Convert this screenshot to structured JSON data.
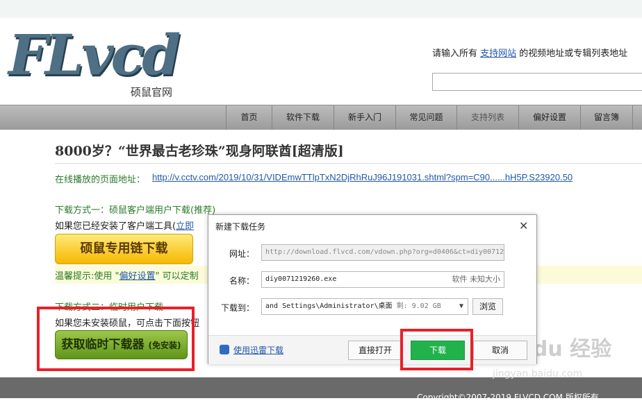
{
  "logo": {
    "text": "FLvcd",
    "subtitle": "硕鼠官网"
  },
  "header": {
    "hint_prefix": "请输入所有 ",
    "hint_link": "支持网站",
    "hint_suffix": " 的视频地址或专辑列表地址"
  },
  "nav": [
    "首页",
    "软件下载",
    "新手入门",
    "常见问题",
    "支持列表",
    "偏好设置",
    "留言簿"
  ],
  "page": {
    "title": "8000岁？“世界最古老珍珠”现身阿联酋[超清版]",
    "play_label": "在线播放的页面地址：",
    "play_url": "http://v.cctv.com/2019/10/31/VIDEmwTTlpTxN2DjRhRuJ96J191031.shtml?spm=C90......hH5P.S23920.50",
    "method1": "下载方式一：硕鼠客户端用户下载(推荐)",
    "installed_prefix": "如果您已经安装了客户端工具(",
    "installed_link": "立即",
    "client_button": "硕鼠专用链下载",
    "tip_prefix": "温馨提示:使用 \"",
    "tip_link": "偏好设置",
    "tip_suffix": "\" 可以定制",
    "method2": "下载方式二：临时用户下载",
    "not_installed": "如果您未安装硕鼠，可点击下面按钮",
    "temp_button": "获取临时下载器",
    "temp_button_small": "(免安装)"
  },
  "dialog": {
    "title": "新建下载任务",
    "close_glyph": "✕",
    "url_label": "网址：",
    "url_value": "http://download.flvcd.com/vdown.php?org=d0406&ct=diy00712",
    "name_label": "名称：",
    "name_value": "diy0071219260.exe",
    "name_meta": "软件 未知大小",
    "path_label": "下载到：",
    "path_value": "and Settings\\Administrator\\桌面",
    "path_meta": "剩: 9.02 GB",
    "path_arrow": "▼",
    "browse_label": "浏览",
    "thunder_link": "使用迅雷下载",
    "open_label": "直接打开",
    "download_label": "下载",
    "cancel_label": "取消"
  },
  "footer": {
    "copyright": "Copyright©2007-2019 FLVCD.COM 版权所有"
  },
  "watermark": {
    "line1": "Bai du 经验",
    "line2": "jingyan.baidu.com"
  },
  "colors": {
    "accent_green": "#22b24c",
    "highlight_red": "#e8202a",
    "link_blue": "#2257a8"
  }
}
